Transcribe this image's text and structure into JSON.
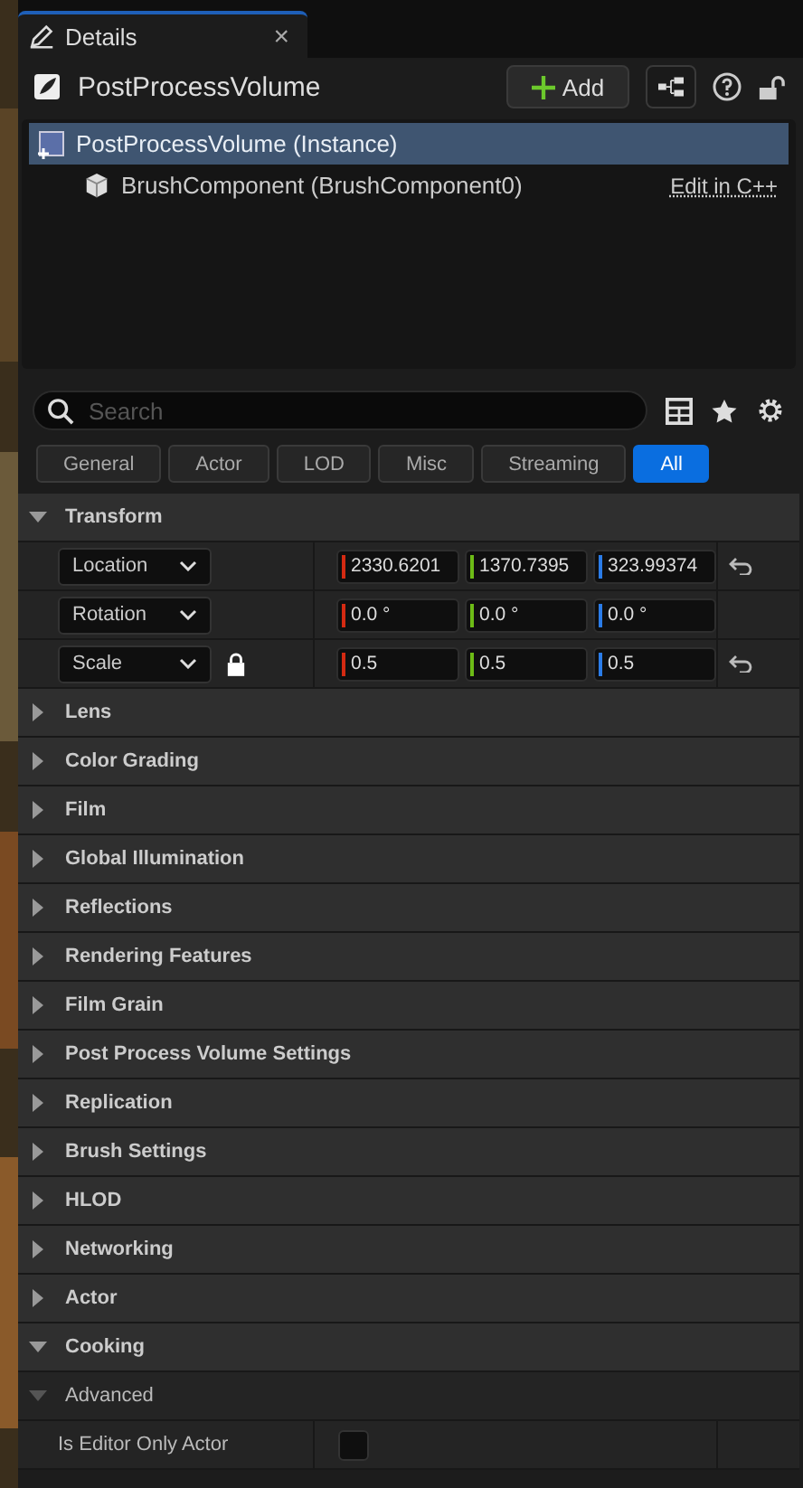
{
  "tab": {
    "title": "Details",
    "close": "×"
  },
  "header": {
    "title": "PostProcessVolume",
    "add_button": "Add"
  },
  "tree": [
    {
      "label": "PostProcessVolume (Instance)",
      "selected": true,
      "children": [
        {
          "label": "BrushComponent (BrushComponent0)",
          "selected": false,
          "link": "Edit in C++"
        }
      ]
    }
  ],
  "search": {
    "placeholder": "Search"
  },
  "filters": [
    {
      "label": "General",
      "selected": false
    },
    {
      "label": "Actor",
      "selected": false
    },
    {
      "label": "LOD",
      "selected": false
    },
    {
      "label": "Misc",
      "selected": false
    },
    {
      "label": "Streaming",
      "selected": false
    },
    {
      "label": "All",
      "selected": true
    }
  ],
  "sections": [
    {
      "title": "Transform",
      "expanded": true,
      "rows": [
        {
          "kind": "vector",
          "label": "Location",
          "locked": false,
          "resettable": true,
          "values": [
            {
              "text": "2330.6201",
              "color": "#d42a12"
            },
            {
              "text": "1370.7395",
              "color": "#6dbb16"
            },
            {
              "text": "323.99374",
              "color": "#2a7ce8"
            }
          ]
        },
        {
          "kind": "vector",
          "label": "Rotation",
          "locked": false,
          "resettable": false,
          "values": [
            {
              "text": "0.0 °",
              "color": "#d42a12"
            },
            {
              "text": "0.0 °",
              "color": "#6dbb16"
            },
            {
              "text": "0.0 °",
              "color": "#2a7ce8"
            }
          ]
        },
        {
          "kind": "vector",
          "label": "Scale",
          "locked": true,
          "resettable": true,
          "values": [
            {
              "text": "0.5",
              "color": "#d42a12"
            },
            {
              "text": "0.5",
              "color": "#6dbb16"
            },
            {
              "text": "0.5",
              "color": "#2a7ce8"
            }
          ]
        }
      ]
    },
    {
      "title": "Lens",
      "expanded": false
    },
    {
      "title": "Color Grading",
      "expanded": false
    },
    {
      "title": "Film",
      "expanded": false
    },
    {
      "title": "Global Illumination",
      "expanded": false
    },
    {
      "title": "Reflections",
      "expanded": false
    },
    {
      "title": "Rendering Features",
      "expanded": false
    },
    {
      "title": "Film Grain",
      "expanded": false
    },
    {
      "title": "Post Process Volume Settings",
      "expanded": false
    },
    {
      "title": "Replication",
      "expanded": false
    },
    {
      "title": "Brush Settings",
      "expanded": false
    },
    {
      "title": "HLOD",
      "expanded": false
    },
    {
      "title": "Networking",
      "expanded": false
    },
    {
      "title": "Actor",
      "expanded": false
    },
    {
      "title": "Cooking",
      "expanded": true,
      "subsections": [
        {
          "title": "Advanced",
          "expanded": true,
          "rows": [
            {
              "kind": "checkbox",
              "label": "Is Editor Only Actor",
              "checked": false
            }
          ]
        }
      ]
    }
  ]
}
